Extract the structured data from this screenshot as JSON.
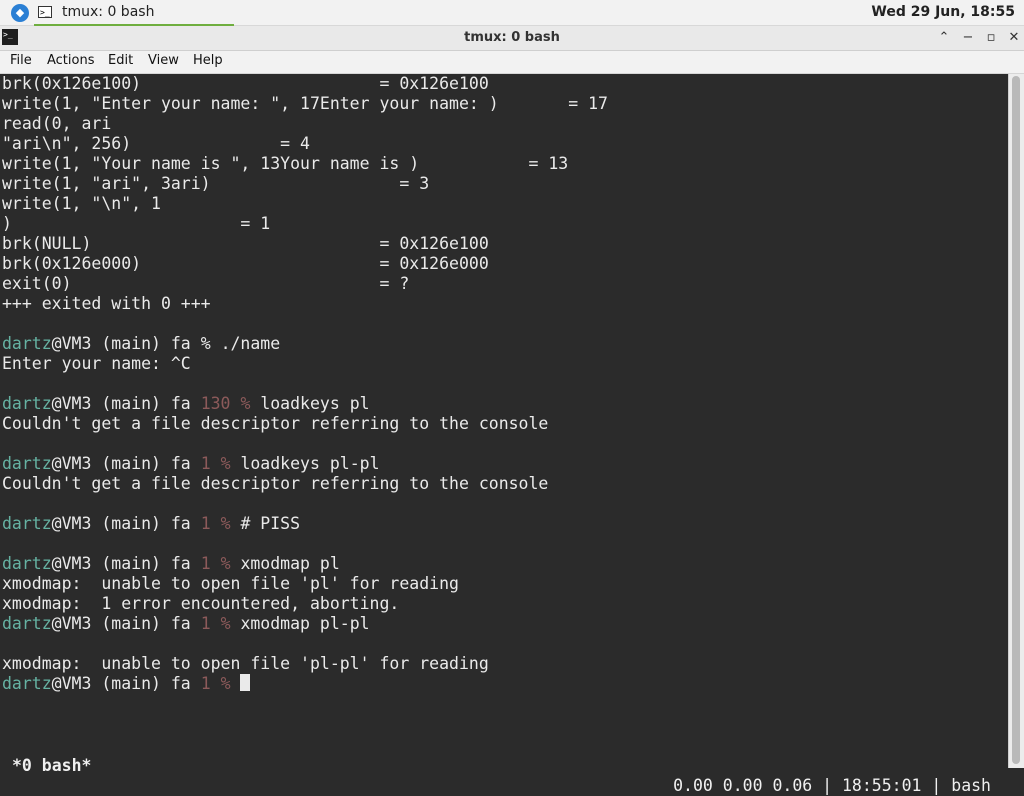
{
  "panel": {
    "task_label": "tmux: 0 bash",
    "clock": "Wed 29 Jun, 18:55",
    "menu_icon": "distro-logo-icon",
    "task_icon": "terminal-icon"
  },
  "window": {
    "title": "tmux: 0 bash",
    "controls": [
      "▲",
      "—",
      "□",
      "✕"
    ]
  },
  "menubar": [
    "File",
    "Actions",
    "Edit",
    "View",
    "Help"
  ],
  "terminal": {
    "lines": [
      "brk(0x126e100)                        = 0x126e100",
      "write(1, \"Enter your name: \", 17Enter your name: )       = 17",
      "read(0, ari",
      "\"ari\\n\", 256)               = 4",
      "write(1, \"Your name is \", 13Your name is )           = 13",
      "write(1, \"ari\", 3ari)                   = 3",
      "write(1, \"\\n\", 1",
      ")                       = 1",
      "brk(NULL)                             = 0x126e100",
      "brk(0x126e000)                        = 0x126e000",
      "exit(0)                               = ?",
      "+++ exited with 0 +++",
      "",
      "",
      "Enter your name: ^C",
      "",
      "",
      "Couldn't get a file descriptor referring to the console",
      "",
      "",
      "Couldn't get a file descriptor referring to the console",
      "",
      "",
      "",
      "",
      "xmodmap:  unable to open file 'pl' for reading",
      "xmodmap:  1 error encountered, aborting.",
      "",
      "",
      "xmodmap:  unable to open file 'pl-pl' for reading",
      "xmodmap:  1 error encountered, aborting.",
      "",
      ""
    ],
    "prompts": [
      {
        "user": "dartz",
        "rest": "@VM3 (main) fa ",
        "code": "",
        "sym": "% ",
        "cmd": "./name"
      },
      {
        "user": "dartz",
        "rest": "@VM3 (main) fa ",
        "code": "130 ",
        "sym": "% ",
        "cmd": "loadkeys pl"
      },
      {
        "user": "dartz",
        "rest": "@VM3 (main) fa ",
        "code": "1 ",
        "sym": "% ",
        "cmd": "loadkeys pl-pl"
      },
      {
        "user": "dartz",
        "rest": "@VM3 (main) fa ",
        "code": "1 ",
        "sym": "% ",
        "cmd": "# PISS"
      },
      {
        "user": "dartz",
        "rest": "@VM3 (main) fa ",
        "code": "1 ",
        "sym": "% ",
        "cmd": "xmodmap pl"
      },
      {
        "user": "dartz",
        "rest": "@VM3 (main) fa ",
        "code": "1 ",
        "sym": "% ",
        "cmd": "xmodmap pl-pl"
      },
      {
        "user": "dartz",
        "rest": "@VM3 (main) fa ",
        "code": "1 ",
        "sym": "% ",
        "cmd": ""
      }
    ]
  },
  "status": {
    "window_label": "*0 bash*",
    "right": "0.00 0.00 0.06 | 18:55:01 | bash"
  },
  "colors": {
    "user": "#66b3a3",
    "error_code": "#8c5a5a",
    "terminal_bg": "#2b2b2b",
    "terminal_fg": "#eaeaea"
  }
}
